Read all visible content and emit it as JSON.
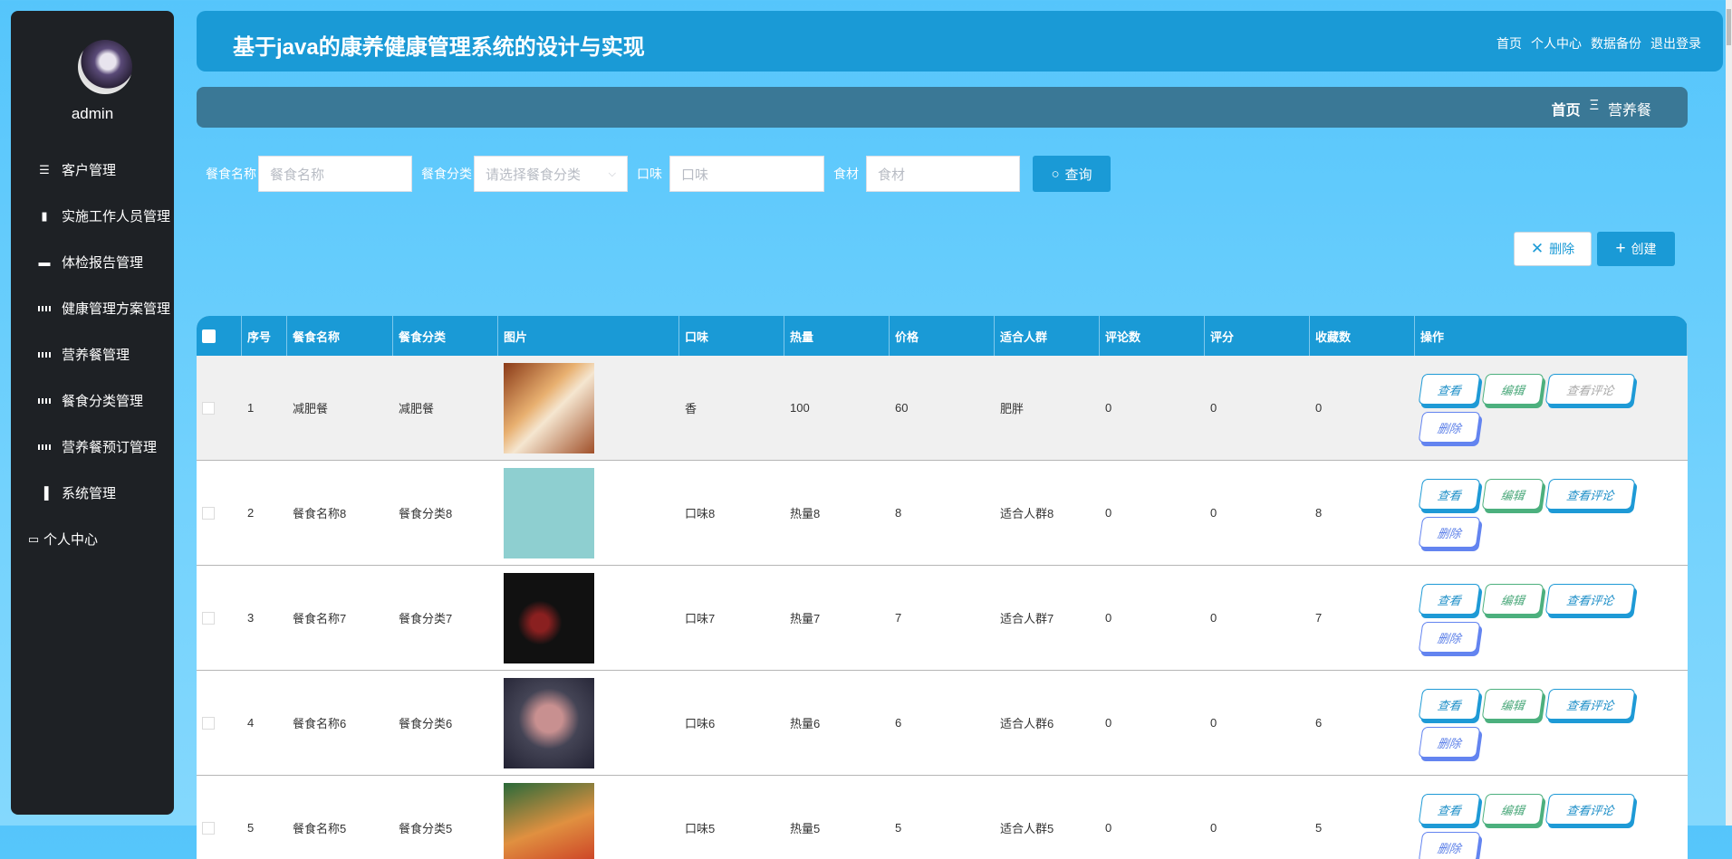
{
  "sidebar": {
    "username": "admin",
    "items": [
      {
        "label": "客户管理",
        "icon": "sliders-icon"
      },
      {
        "label": "实施工作人员管理",
        "icon": "briefcase-icon"
      },
      {
        "label": "体检报告管理",
        "icon": "ticket-icon"
      },
      {
        "label": "健康管理方案管理",
        "icon": "grid-icon"
      },
      {
        "label": "营养餐管理",
        "icon": "grid-icon"
      },
      {
        "label": "餐食分类管理",
        "icon": "grid-icon"
      },
      {
        "label": "营养餐预订管理",
        "icon": "grid-icon"
      },
      {
        "label": "系统管理",
        "icon": "bar-chart-icon"
      },
      {
        "label": "个人中心",
        "icon": "card-icon"
      }
    ]
  },
  "header": {
    "title": "基于java的康养健康管理系统的设计与实现",
    "nav": [
      "首页",
      "个人中心",
      "数据备份",
      "退出登录"
    ]
  },
  "breadcrumb": {
    "home": "首页",
    "sep": "Ξ",
    "current": "营养餐"
  },
  "search": {
    "name_label": "餐食名称",
    "name_placeholder": "餐食名称",
    "category_label": "餐食分类",
    "category_placeholder": "请选择餐食分类",
    "taste_label": "口味",
    "taste_placeholder": "口味",
    "ingredient_label": "食材",
    "ingredient_placeholder": "食材",
    "query_label": "查询"
  },
  "actions": {
    "delete_label": "删除",
    "create_label": "创建"
  },
  "table": {
    "headers": [
      "序号",
      "餐食名称",
      "餐食分类",
      "图片",
      "口味",
      "热量",
      "价格",
      "适合人群",
      "评论数",
      "评分",
      "收藏数",
      "操作"
    ],
    "op_labels": {
      "view": "查看",
      "edit": "编辑",
      "reviews": "查看评论",
      "delete": "删除"
    },
    "rows": [
      [
        "1",
        "减肥餐",
        "减肥餐",
        "香",
        "100",
        "60",
        "肥胖",
        "0",
        "0",
        "0"
      ],
      [
        "2",
        "餐食名称8",
        "餐食分类8",
        "口味8",
        "热量8",
        "8",
        "适合人群8",
        "0",
        "0",
        "8"
      ],
      [
        "3",
        "餐食名称7",
        "餐食分类7",
        "口味7",
        "热量7",
        "7",
        "适合人群7",
        "0",
        "0",
        "7"
      ],
      [
        "4",
        "餐食名称6",
        "餐食分类6",
        "口味6",
        "热量6",
        "6",
        "适合人群6",
        "0",
        "0",
        "6"
      ],
      [
        "5",
        "餐食名称5",
        "餐食分类5",
        "口味5",
        "热量5",
        "5",
        "适合人群5",
        "0",
        "0",
        "5"
      ]
    ]
  },
  "colors": {
    "accent": "#1a9ad6",
    "sidebar": "#1e2125",
    "breadcrumb": "#3a7896"
  }
}
